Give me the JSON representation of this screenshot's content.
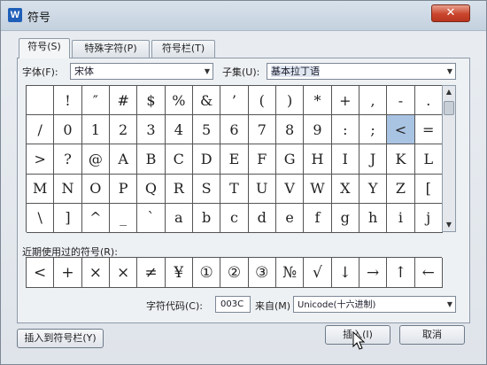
{
  "window": {
    "icon_letter": "W",
    "title": "符号",
    "close_label": "✕"
  },
  "tabs": [
    {
      "label": "符号(S)",
      "active": true
    },
    {
      "label": "特殊字符(P)",
      "active": false
    },
    {
      "label": "符号栏(T)",
      "active": false
    }
  ],
  "font": {
    "label": "字体(F):",
    "value": "宋体"
  },
  "subset": {
    "label": "子集(U):",
    "value": "基本拉丁语"
  },
  "symbols": [
    "",
    "!",
    "″",
    "#",
    "$",
    "%",
    "&",
    "’",
    "(",
    ")",
    "*",
    "+",
    ",",
    "-",
    ".",
    "/",
    "0",
    "1",
    "2",
    "3",
    "4",
    "5",
    "6",
    "7",
    "8",
    "9",
    ":",
    ";",
    "<",
    "=",
    ">",
    "?",
    "@",
    "A",
    "B",
    "C",
    "D",
    "E",
    "F",
    "G",
    "H",
    "I",
    "J",
    "K",
    "L",
    "M",
    "N",
    "O",
    "P",
    "Q",
    "R",
    "S",
    "T",
    "U",
    "V",
    "W",
    "X",
    "Y",
    "Z",
    "[",
    "\\",
    "]",
    "^",
    "_",
    "`",
    "a",
    "b",
    "c",
    "d",
    "e",
    "f",
    "g",
    "h",
    "i",
    "j"
  ],
  "selected_symbol_index": 28,
  "recent": {
    "label": "近期使用过的符号(R):",
    "symbols": [
      "<",
      "+",
      "×",
      "×",
      "≠",
      "¥",
      "①",
      "②",
      "③",
      "№",
      "√",
      "↓",
      "→",
      "↑",
      "←"
    ]
  },
  "char_code": {
    "label": "字符代码(C):",
    "value": "003C"
  },
  "from": {
    "label": "来自(M)",
    "value": "Unicode(十六进制)"
  },
  "buttons": {
    "insert_to_bar": "插入到符号栏(Y)",
    "insert": "插入(I)",
    "cancel": "取消"
  },
  "colors": {
    "accent_selection": "#a9c3e3",
    "close_button": "#c9452c"
  }
}
